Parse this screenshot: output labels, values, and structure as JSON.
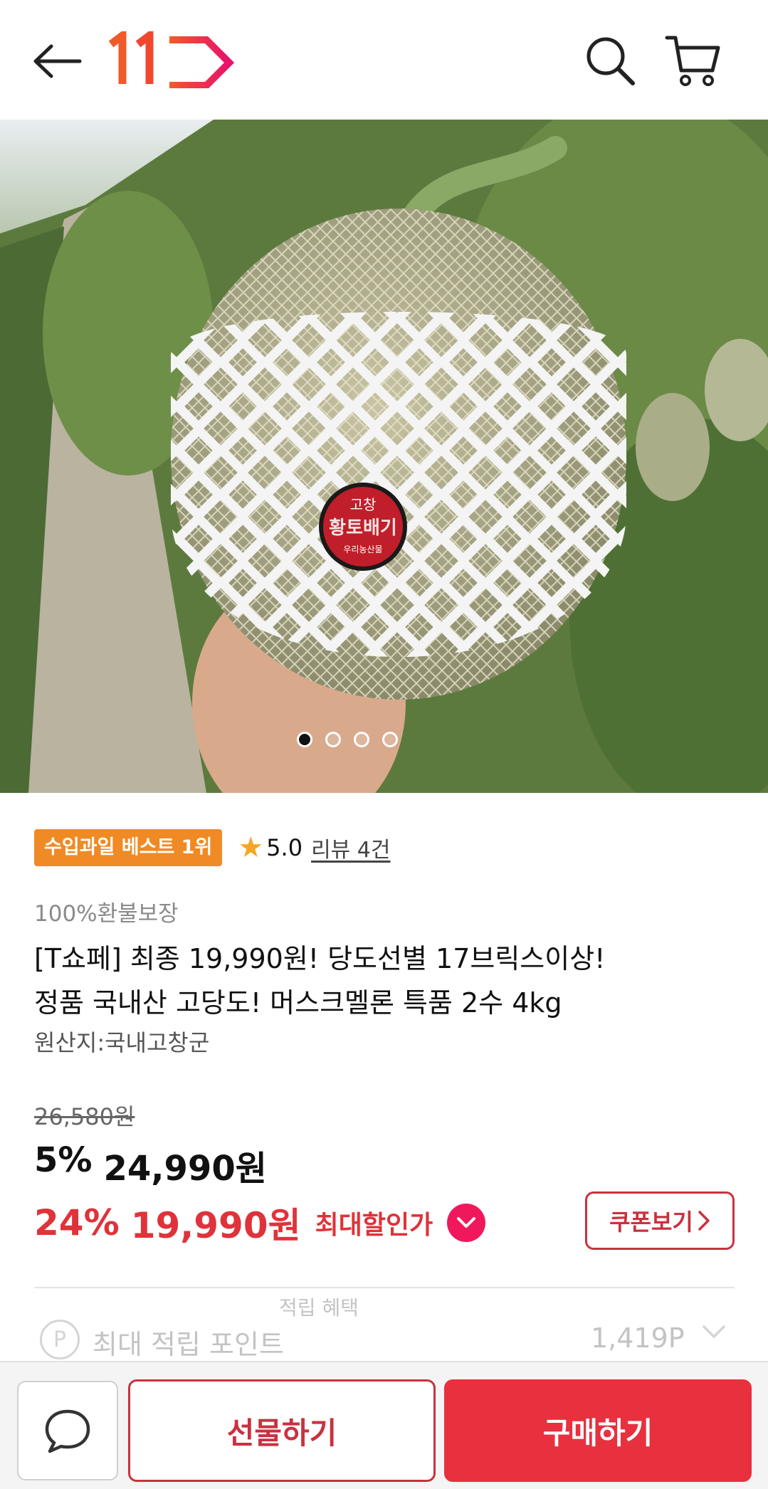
{
  "header": {
    "logo_text": "11",
    "back_icon": "arrow-left-icon",
    "search_icon": "search-icon",
    "cart_icon": "cart-icon",
    "brand_colors": {
      "logo_start": "#f05a28",
      "logo_end": "#e8126c"
    }
  },
  "hero": {
    "label_top": "고창",
    "label_main": "황토배기",
    "label_bottom": "우리농산물",
    "carousel": {
      "count": 4,
      "active_index": 0
    }
  },
  "product": {
    "best_badge": "수입과일 베스트 1위",
    "rating": "5.0",
    "review_text": "리뷰 4건",
    "guarantee": "100%환불보장",
    "title_line1": "[T쇼페] 최종 19,990원! 당도선별 17브릭스이상!",
    "title_line2": "정품 국내산 고당도! 머스크멜론 특품 2수 4kg",
    "origin": "원산지:국내고창군"
  },
  "price": {
    "original": "26,580원",
    "sale_percent": "5%",
    "sale_price": "24,990원",
    "max_percent": "24%",
    "max_price": "19,990원",
    "max_label": "최대할인가",
    "coupon_label": "쿠폰보기"
  },
  "points": {
    "peek_text": "적립 혜택",
    "label": "최대 적립 포인트",
    "value": "1,419P",
    "icon_letter": "P"
  },
  "bottom_bar": {
    "gift_label": "선물하기",
    "buy_label": "구매하기",
    "accent": "#e8303f"
  }
}
